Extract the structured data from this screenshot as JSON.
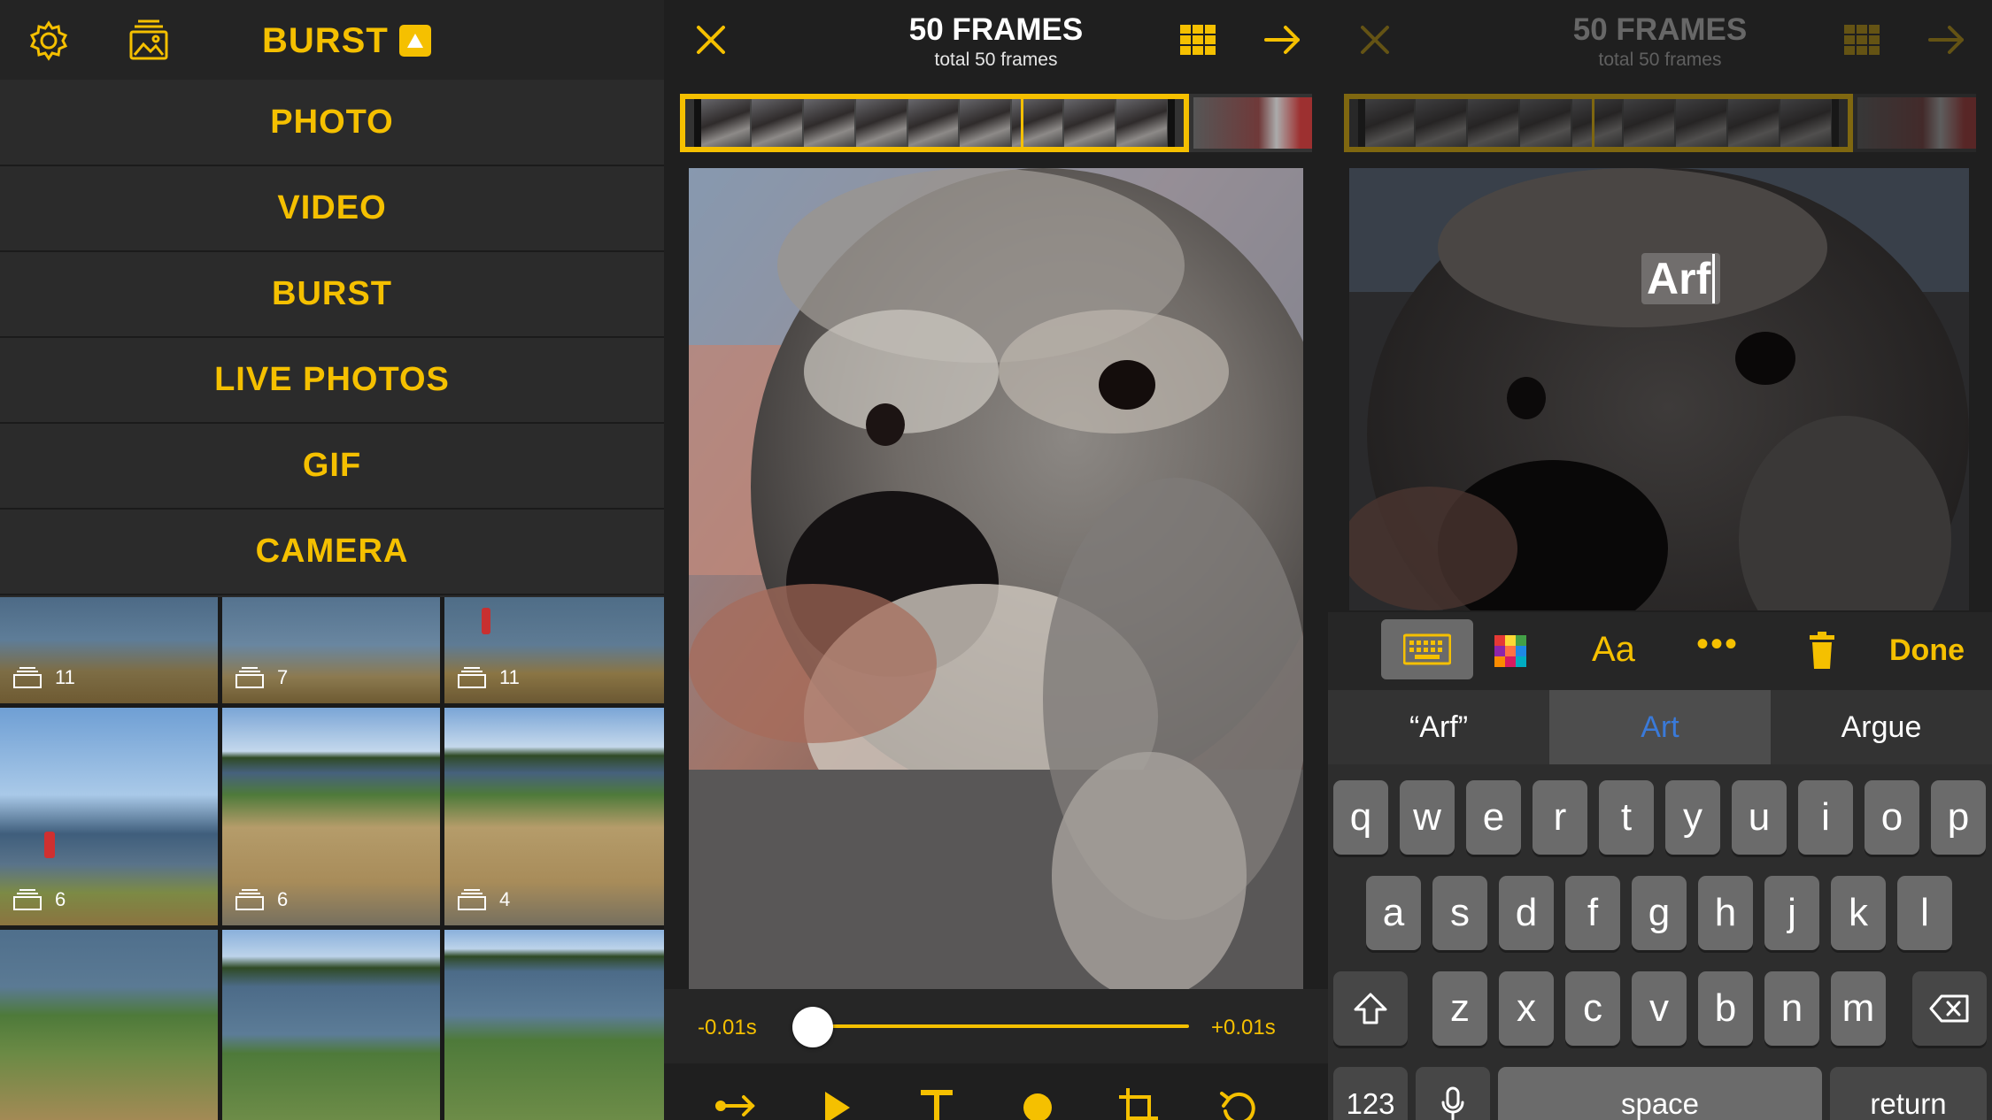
{
  "brand": {
    "yellow": "#f5c000",
    "bg_dark": "#1f1f1f",
    "panel_bg": "#2a2a2a"
  },
  "home": {
    "title": "BURST",
    "menu": [
      "PHOTO",
      "VIDEO",
      "BURST",
      "LIVE PHOTOS",
      "GIF",
      "CAMERA"
    ],
    "thumbnails": [
      {
        "count": "11"
      },
      {
        "count": "7"
      },
      {
        "count": "11"
      },
      {
        "count": "6"
      },
      {
        "count": "6"
      },
      {
        "count": "4"
      },
      {
        "count": ""
      },
      {
        "count": ""
      },
      {
        "count": ""
      }
    ]
  },
  "editor": {
    "title": "50 FRAMES",
    "subtitle": "total 50 frames",
    "slider": {
      "min_label": "-0.01s",
      "max_label": "+0.01s",
      "value_fraction": 0.04
    },
    "toolbar_icons": [
      "loop-forward-icon",
      "play-icon",
      "text-icon",
      "color-dot-icon",
      "crop-icon",
      "undo-icon"
    ]
  },
  "text_editor": {
    "title": "50 FRAMES",
    "subtitle": "total 50 frames",
    "overlay_text": "Arf",
    "done_label": "Done",
    "font_label": "Aa",
    "more_label": "•••",
    "suggestions": [
      "“Arf”",
      "Art",
      "Argue"
    ],
    "keys_row1": [
      "q",
      "w",
      "e",
      "r",
      "t",
      "y",
      "u",
      "i",
      "o",
      "p"
    ],
    "keys_row2": [
      "a",
      "s",
      "d",
      "f",
      "g",
      "h",
      "j",
      "k",
      "l"
    ],
    "keys_row3": [
      "z",
      "x",
      "c",
      "v",
      "b",
      "n",
      "m"
    ],
    "key_123": "123",
    "key_space": "space",
    "key_return": "return"
  }
}
